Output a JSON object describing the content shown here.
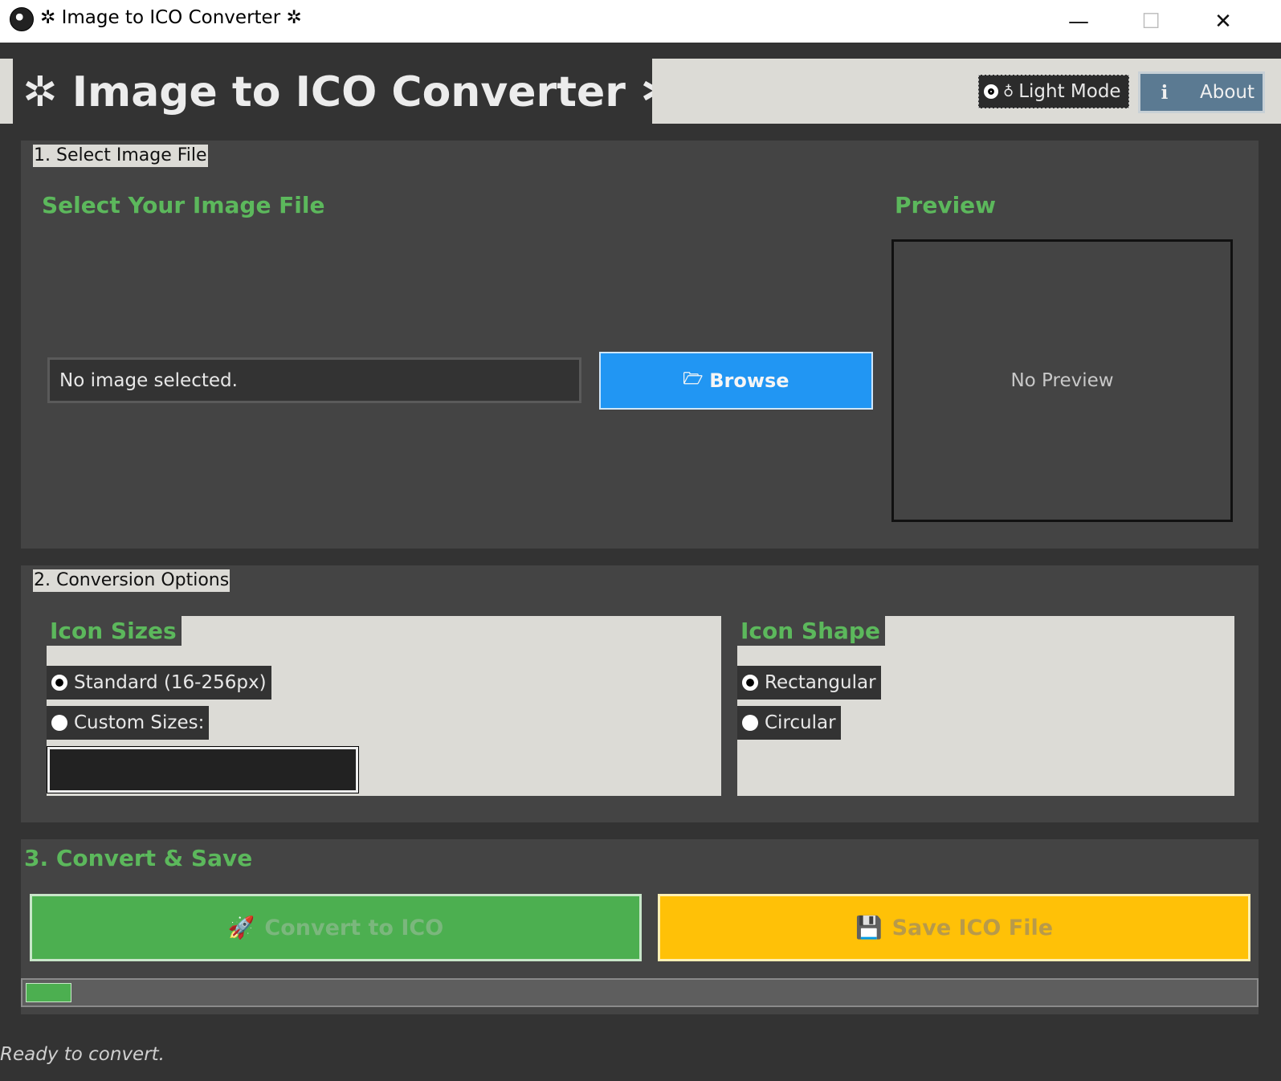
{
  "window": {
    "title": "Image to ICO Converter",
    "controls": {
      "minimize": "—",
      "maximize": "☐",
      "close": "✕"
    }
  },
  "header": {
    "title": "Image to ICO Converter",
    "light_mode_label": "Light Mode",
    "about_icon": "i",
    "about_label": "About"
  },
  "select_section": {
    "legend": "1. Select Image File",
    "heading": "Select Your Image File",
    "file_value": "No image selected.",
    "browse_label": "Browse",
    "preview_heading": "Preview",
    "preview_text": "No Preview"
  },
  "options_section": {
    "legend": "2. Conversion Options",
    "icon_sizes": {
      "title": "Icon Sizes",
      "standard_label": "Standard (16-256px)",
      "custom_label": "Custom Sizes:",
      "custom_value": "",
      "selected": "standard"
    },
    "icon_shape": {
      "title": "Icon Shape",
      "rectangular_label": "Rectangular",
      "circular_label": "Circular",
      "selected": "rectangular"
    }
  },
  "convert_section": {
    "heading": "3. Convert & Save",
    "convert_label": "Convert to ICO",
    "save_label": "Save ICO File",
    "progress_fraction": 0.037
  },
  "status_text": "Ready to convert.",
  "icons": {
    "app": "globe-icon",
    "sparkle": "sparkle-icon",
    "bulb": "bulb-icon",
    "folder": "folder-icon",
    "rocket": "rocket-icon",
    "save": "floppy-icon"
  },
  "colors": {
    "accent_green": "#5cb85c",
    "browse_blue": "#2196f3",
    "convert_green": "#4caf50",
    "save_amber": "#ffc107",
    "panel_bg": "#444444",
    "window_bg": "#333333",
    "light_bg": "#dcdbd6"
  }
}
